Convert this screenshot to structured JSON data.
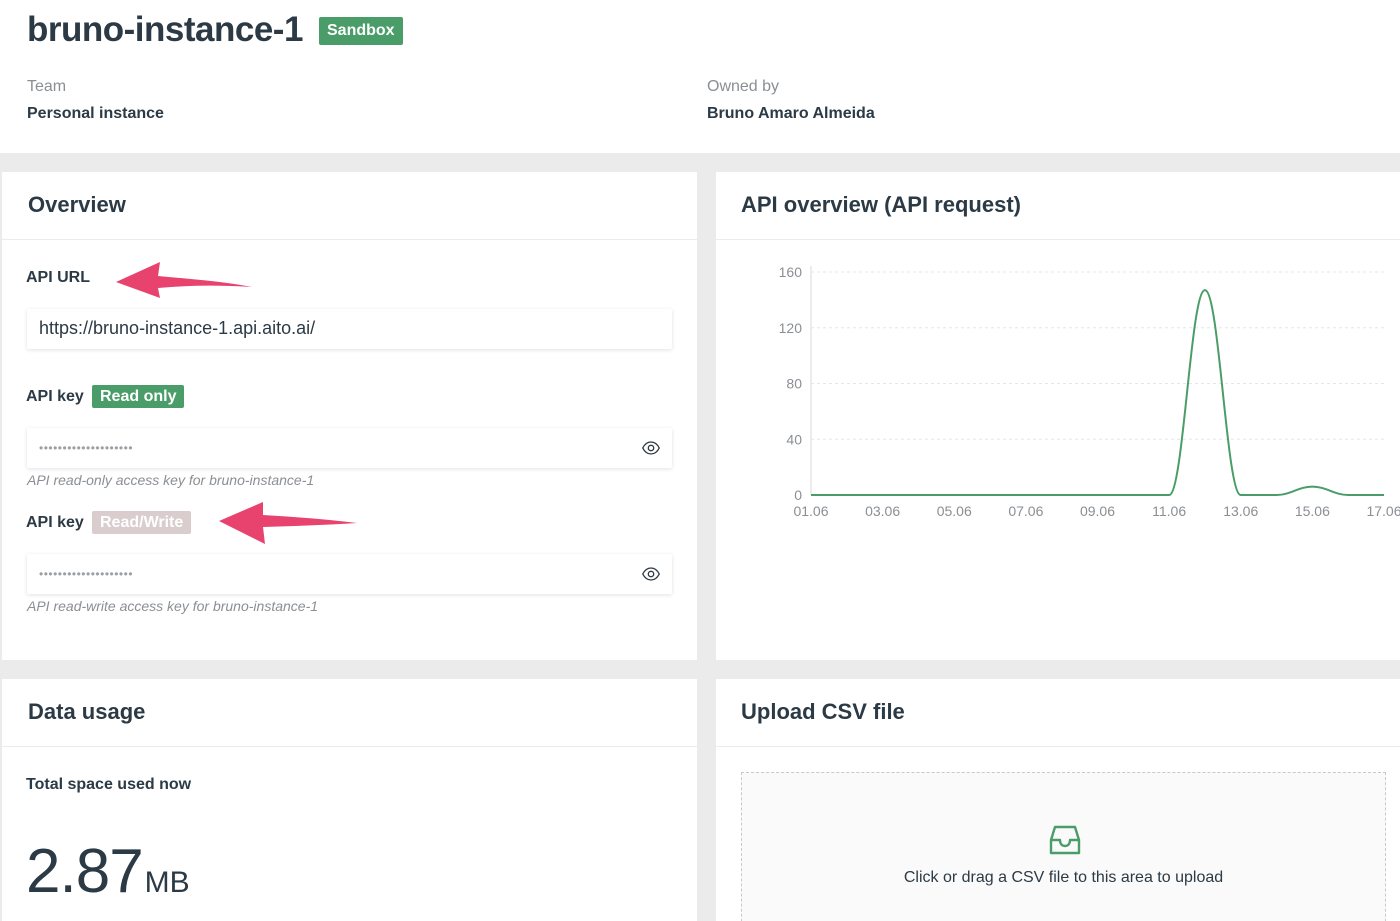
{
  "instance": {
    "name": "bruno-instance-1",
    "badge": "Sandbox",
    "team_label": "Team",
    "team_value": "Personal instance",
    "owner_label": "Owned by",
    "owner_value": "Bruno Amaro Almeida"
  },
  "overview": {
    "title": "Overview",
    "api_url_label": "API URL",
    "api_url_value": "https://bruno-instance-1.api.aito.ai/",
    "read_key": {
      "label": "API key",
      "badge": "Read only",
      "masked": "••••••••••••••••••••",
      "helper": "API read-only access key for bruno-instance-1",
      "icon": "eye-icon"
    },
    "write_key": {
      "label": "API key",
      "badge": "Read/Write",
      "masked": "••••••••••••••••••••",
      "helper": "API read-write access key for bruno-instance-1",
      "icon": "eye-icon"
    }
  },
  "api_overview": {
    "title": "API overview (API request)"
  },
  "chart_data": {
    "type": "line",
    "title": "",
    "xlabel": "",
    "ylabel": "",
    "x": [
      "01.06",
      "02.06",
      "03.06",
      "04.06",
      "05.06",
      "06.06",
      "07.06",
      "08.06",
      "09.06",
      "10.06",
      "11.06",
      "12.06",
      "13.06",
      "14.06",
      "15.06",
      "16.06",
      "17.06"
    ],
    "series": [
      {
        "values": [
          0,
          0,
          0,
          0,
          0,
          0,
          0,
          0,
          0,
          0,
          0,
          147,
          0,
          0,
          6,
          0,
          0
        ]
      }
    ],
    "x_tick_labels": [
      "01.06",
      "03.06",
      "05.06",
      "07.06",
      "09.06",
      "11.06",
      "13.06",
      "15.06",
      "17.06"
    ],
    "y_ticks": [
      0,
      40,
      80,
      120,
      160
    ],
    "ylim": [
      0,
      160
    ],
    "grid": true,
    "color": "#4a9d69"
  },
  "data_usage": {
    "title": "Data usage",
    "label": "Total space used now",
    "value": "2.87",
    "unit": "MB"
  },
  "upload": {
    "title": "Upload CSV file",
    "icon": "inbox-icon",
    "text": "Click or drag a CSV file to this area to upload"
  },
  "colors": {
    "accent": "#4a9d69",
    "annotation_arrow": "#e8436f",
    "rw_badge": "#d9cdcd"
  }
}
